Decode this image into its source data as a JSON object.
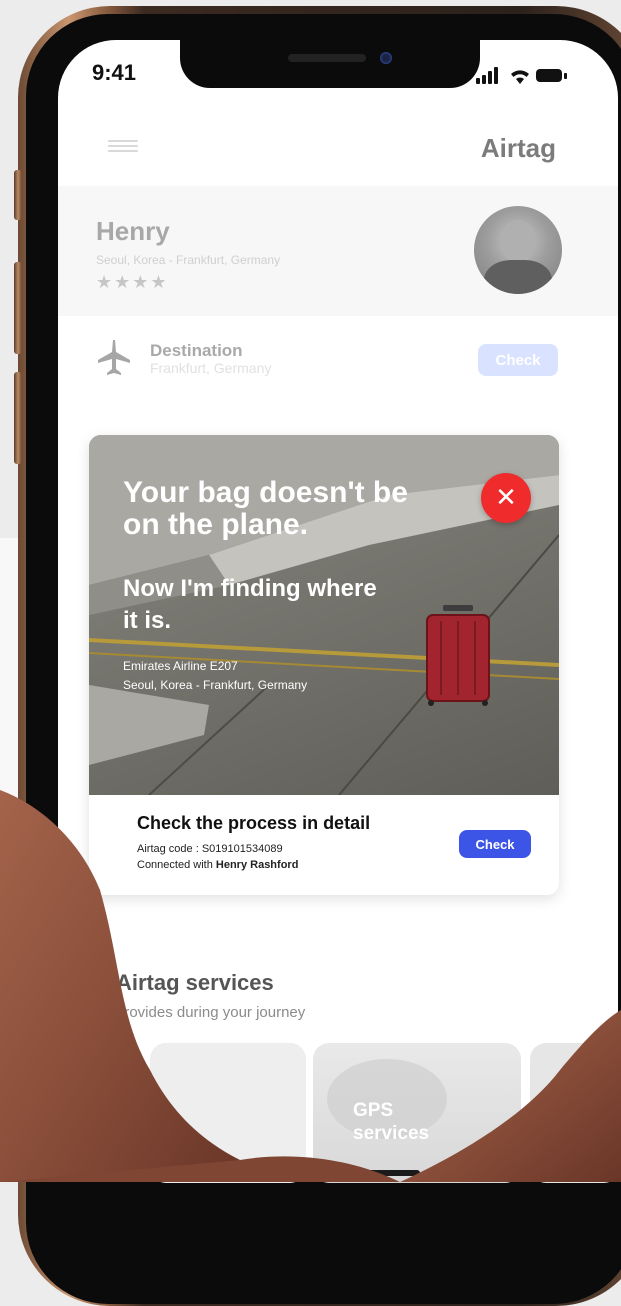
{
  "status_bar": {
    "time": "9:41"
  },
  "header": {
    "title": "Airtag"
  },
  "profile": {
    "name": "Henry",
    "route": "Seoul, Korea - Frankfurt, Germany",
    "rating_stars": "★★★★"
  },
  "destination": {
    "label": "Destination",
    "value": "Frankfurt, Germany",
    "check_label": "Check"
  },
  "alert": {
    "title": "Your bag doesn't be on the plane.",
    "subtitle": "Now I'm finding where it is.",
    "flight": "Emirates Airline E207",
    "route": "Seoul, Korea - Frankfurt, Germany",
    "close_symbol": "✕",
    "detail_title": "Check the process in detail",
    "airtag_code": "Airtag code : S019101534089",
    "connected_prefix": "Connected with",
    "connected_name": "Henry Rashford",
    "check_label": "Check"
  },
  "services": {
    "title": "Airtag services",
    "subtitle": "provides during your journey",
    "cards": [
      {
        "label": ""
      },
      {
        "label": "GPS services"
      },
      {
        "label": ""
      }
    ]
  },
  "colors": {
    "accent_blue": "#3c55e6",
    "alert_red": "#f02b2b",
    "pale_blue": "#d9e2ff"
  },
  "icons": [
    "menu-icon",
    "plane-icon",
    "close-icon",
    "signal-icon",
    "wifi-icon",
    "battery-icon"
  ]
}
